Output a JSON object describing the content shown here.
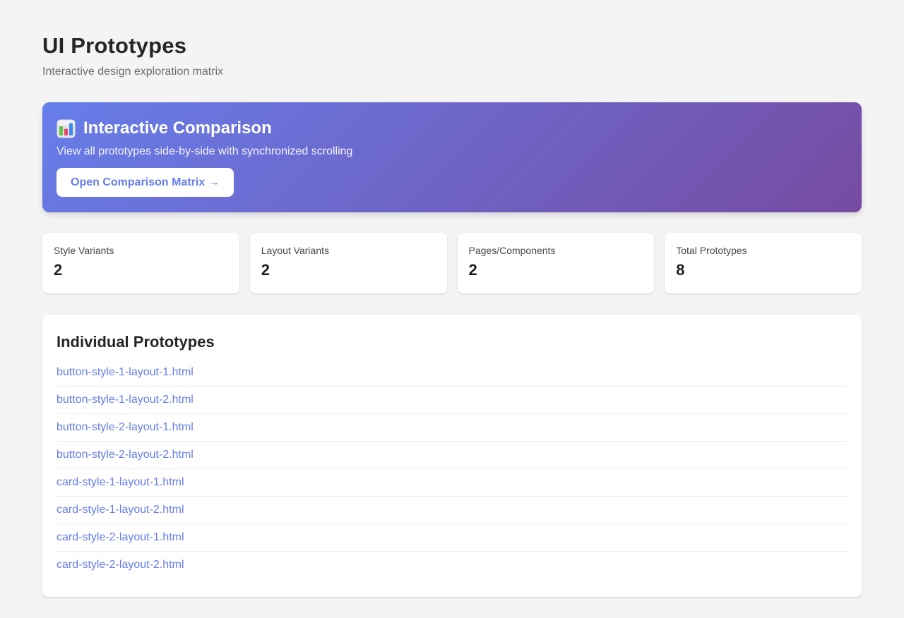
{
  "page": {
    "title": "UI Prototypes",
    "subtitle": "Interactive design exploration matrix"
  },
  "banner": {
    "icon": "bar-chart",
    "title": "Interactive Comparison",
    "description": "View all prototypes side-by-side with synchronized scrolling",
    "button_label": "Open Comparison Matrix →",
    "gradient_start": "#667eea",
    "gradient_end": "#764ba2"
  },
  "stats": [
    {
      "label": "Style Variants",
      "value": "2"
    },
    {
      "label": "Layout Variants",
      "value": "2"
    },
    {
      "label": "Pages/Components",
      "value": "2"
    },
    {
      "label": "Total Prototypes",
      "value": "8"
    }
  ],
  "prototypes": {
    "title": "Individual Prototypes",
    "links": [
      "button-style-1-layout-1.html",
      "button-style-1-layout-2.html",
      "button-style-2-layout-1.html",
      "button-style-2-layout-2.html",
      "card-style-1-layout-1.html",
      "card-style-1-layout-2.html",
      "card-style-2-layout-1.html",
      "card-style-2-layout-2.html"
    ]
  },
  "colors": {
    "accent": "#667eea",
    "page_background": "#f4f4f5",
    "card_background": "#ffffff",
    "link": "#667eea"
  }
}
